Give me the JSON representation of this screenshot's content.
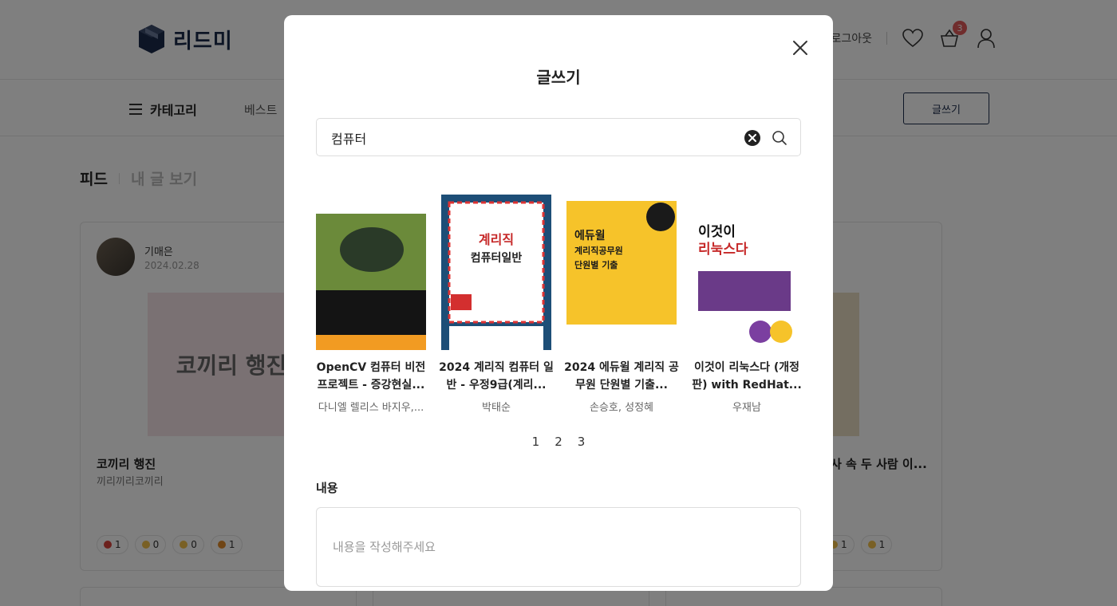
{
  "header": {
    "logo_text": "리드미",
    "logout_label": "로그아웃",
    "cart_count": "3"
  },
  "nav": {
    "category_label": "카테고리",
    "best_label": "베스트",
    "write_label": "글쓰기"
  },
  "feed_tabs": {
    "feed": "피드",
    "my_posts": "내 글 보기"
  },
  "feed_cards": [
    {
      "author": "기매은",
      "date": "2024.02.28",
      "cover_text": "코끼리 행진",
      "title": "코끼리 행진",
      "subtitle": "끼리끼리코끼리",
      "reactions": [
        {
          "count": "1",
          "color": "#d9433b"
        },
        {
          "count": "0",
          "color": "#f2c04a"
        },
        {
          "count": "0",
          "color": "#f2c04a"
        },
        {
          "count": "1",
          "color": "#e08a2a"
        }
      ]
    },
    {
      "title_fragment": "사 속 두 사람 이...",
      "reactions": [
        {
          "count": "1",
          "color": "#f2c04a"
        },
        {
          "count": "1",
          "color": "#f2c04a"
        }
      ]
    }
  ],
  "modal": {
    "title": "글쓰기",
    "search": {
      "value": "컴퓨터",
      "placeholder": ""
    },
    "books": [
      {
        "title": "OpenCV 컴퓨터 비전 프로젝트 - 증강현실...",
        "author": "다니엘 렐리스 바지우,...",
        "cover_color": "#1f2d1a"
      },
      {
        "title": "2024 계리직 컴퓨터 일반 - 우정9급(계리...",
        "author": "박태순",
        "cover_color": "#1d4e77"
      },
      {
        "title": "2024 에듀윌 계리직 공무원 단원별 기출...",
        "author": "손승호, 성정혜",
        "cover_color": "#f6c32a"
      },
      {
        "title": "이것이 리눅스다 (개정판) with RedHat...",
        "author": "우재남",
        "cover_color": "#ffffff"
      }
    ],
    "pages": [
      "1",
      "2",
      "3"
    ],
    "content_label": "내용",
    "content_placeholder": "내용을 작성해주세요"
  }
}
